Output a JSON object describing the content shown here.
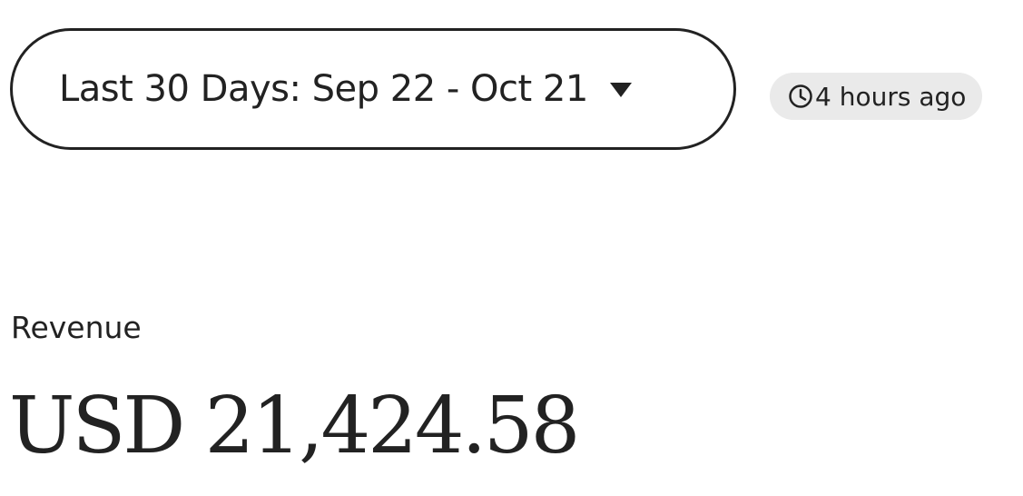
{
  "date_range": {
    "label": "Last 30 Days: Sep 22 - Oct 21",
    "icon": "caret-down-icon"
  },
  "updated": {
    "icon": "clock-icon",
    "text": "4 hours ago"
  },
  "revenue": {
    "label": "Revenue",
    "value": "USD 21,424.58"
  },
  "colors": {
    "text": "#222222",
    "badge_bg": "#eaeaea",
    "background": "#ffffff"
  }
}
